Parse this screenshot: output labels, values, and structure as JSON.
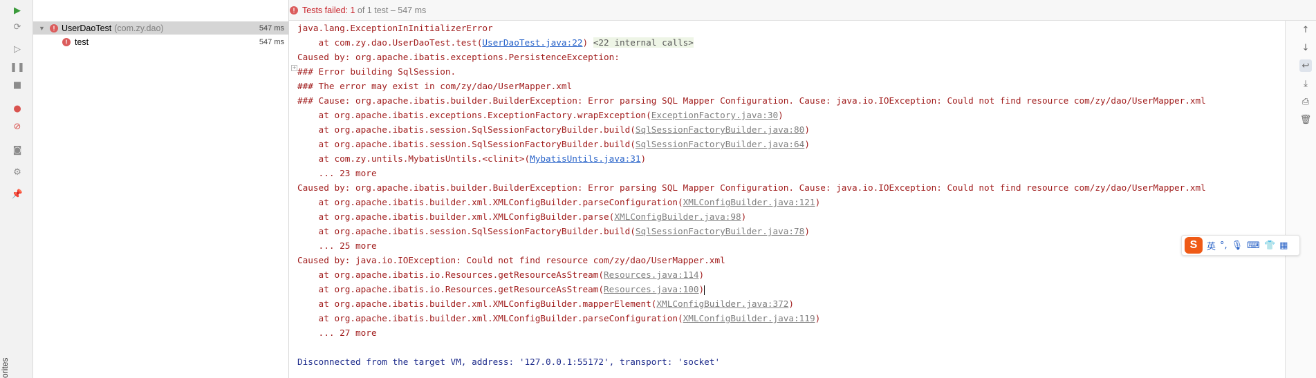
{
  "toolbar": {
    "status_failed_label": "Tests failed: 1",
    "status_rest": " of 1 test – 547 ms",
    "err_glyph": "!"
  },
  "left_bar": {
    "vertical_label": "orites"
  },
  "tree": {
    "suite": {
      "name": "UserDaoTest",
      "package": "(com.zy.dao)",
      "time": "547 ms"
    },
    "test": {
      "name": "test",
      "time": "547 ms"
    }
  },
  "console": {
    "l1": "java.lang.ExceptionInInitializerError",
    "l2_prefix": "    at com.zy.dao.UserDaoTest.test(",
    "l2_link": "UserDaoTest.java:22",
    "l2_suffix": ") ",
    "l2_pill": "<22 internal calls>",
    "l3": "Caused by: org.apache.ibatis.exceptions.PersistenceException: ",
    "l4": "### Error building SqlSession.",
    "l5": "### The error may exist in com/zy/dao/UserMapper.xml",
    "l6": "### Cause: org.apache.ibatis.builder.BuilderException: Error parsing SQL Mapper Configuration. Cause: java.io.IOException: Could not find resource com/zy/dao/UserMapper.xml",
    "l7_prefix": "    at org.apache.ibatis.exceptions.ExceptionFactory.wrapException(",
    "l7_link": "ExceptionFactory.java:30",
    "l8_prefix": "    at org.apache.ibatis.session.SqlSessionFactoryBuilder.build(",
    "l8_link": "SqlSessionFactoryBuilder.java:80",
    "l9_prefix": "    at org.apache.ibatis.session.SqlSessionFactoryBuilder.build(",
    "l9_link": "SqlSessionFactoryBuilder.java:64",
    "l10_prefix": "    at com.zy.untils.MybatisUntils.<clinit>(",
    "l10_link": "MybatisUntils.java:31",
    "l11": "    ... 23 more",
    "l12": "Caused by: org.apache.ibatis.builder.BuilderException: Error parsing SQL Mapper Configuration. Cause: java.io.IOException: Could not find resource com/zy/dao/UserMapper.xml",
    "l13_prefix": "    at org.apache.ibatis.builder.xml.XMLConfigBuilder.parseConfiguration(",
    "l13_link": "XMLConfigBuilder.java:121",
    "l14_prefix": "    at org.apache.ibatis.builder.xml.XMLConfigBuilder.parse(",
    "l14_link": "XMLConfigBuilder.java:98",
    "l15_prefix": "    at org.apache.ibatis.session.SqlSessionFactoryBuilder.build(",
    "l15_link": "SqlSessionFactoryBuilder.java:78",
    "l16": "    ... 25 more",
    "l17": "Caused by: java.io.IOException: Could not find resource com/zy/dao/UserMapper.xml",
    "l18_prefix": "    at org.apache.ibatis.io.Resources.getResourceAsStream(",
    "l18_link": "Resources.java:114",
    "l19_prefix": "    at org.apache.ibatis.io.Resources.getResourceAsStream(",
    "l19_link": "Resources.java:100",
    "l20_prefix": "    at org.apache.ibatis.builder.xml.XMLConfigBuilder.mapperElement(",
    "l20_link": "XMLConfigBuilder.java:372",
    "l21_prefix": "    at org.apache.ibatis.builder.xml.XMLConfigBuilder.parseConfiguration(",
    "l21_link": "XMLConfigBuilder.java:119",
    "l22": "    ... 27 more",
    "l23": "Disconnected from the target VM, address: '127.0.0.1:55172', transport: 'socket'",
    "close_paren": ")"
  },
  "ime": {
    "logo": "S",
    "lang": "英",
    "punct": "°,",
    "mic": "🎙",
    "keyboard": "⌨",
    "shirt": "👕",
    "grid": "▦"
  },
  "colors": {
    "error": "#db5c5c",
    "link": "#2762c9",
    "failed_text": "#c7222a"
  }
}
